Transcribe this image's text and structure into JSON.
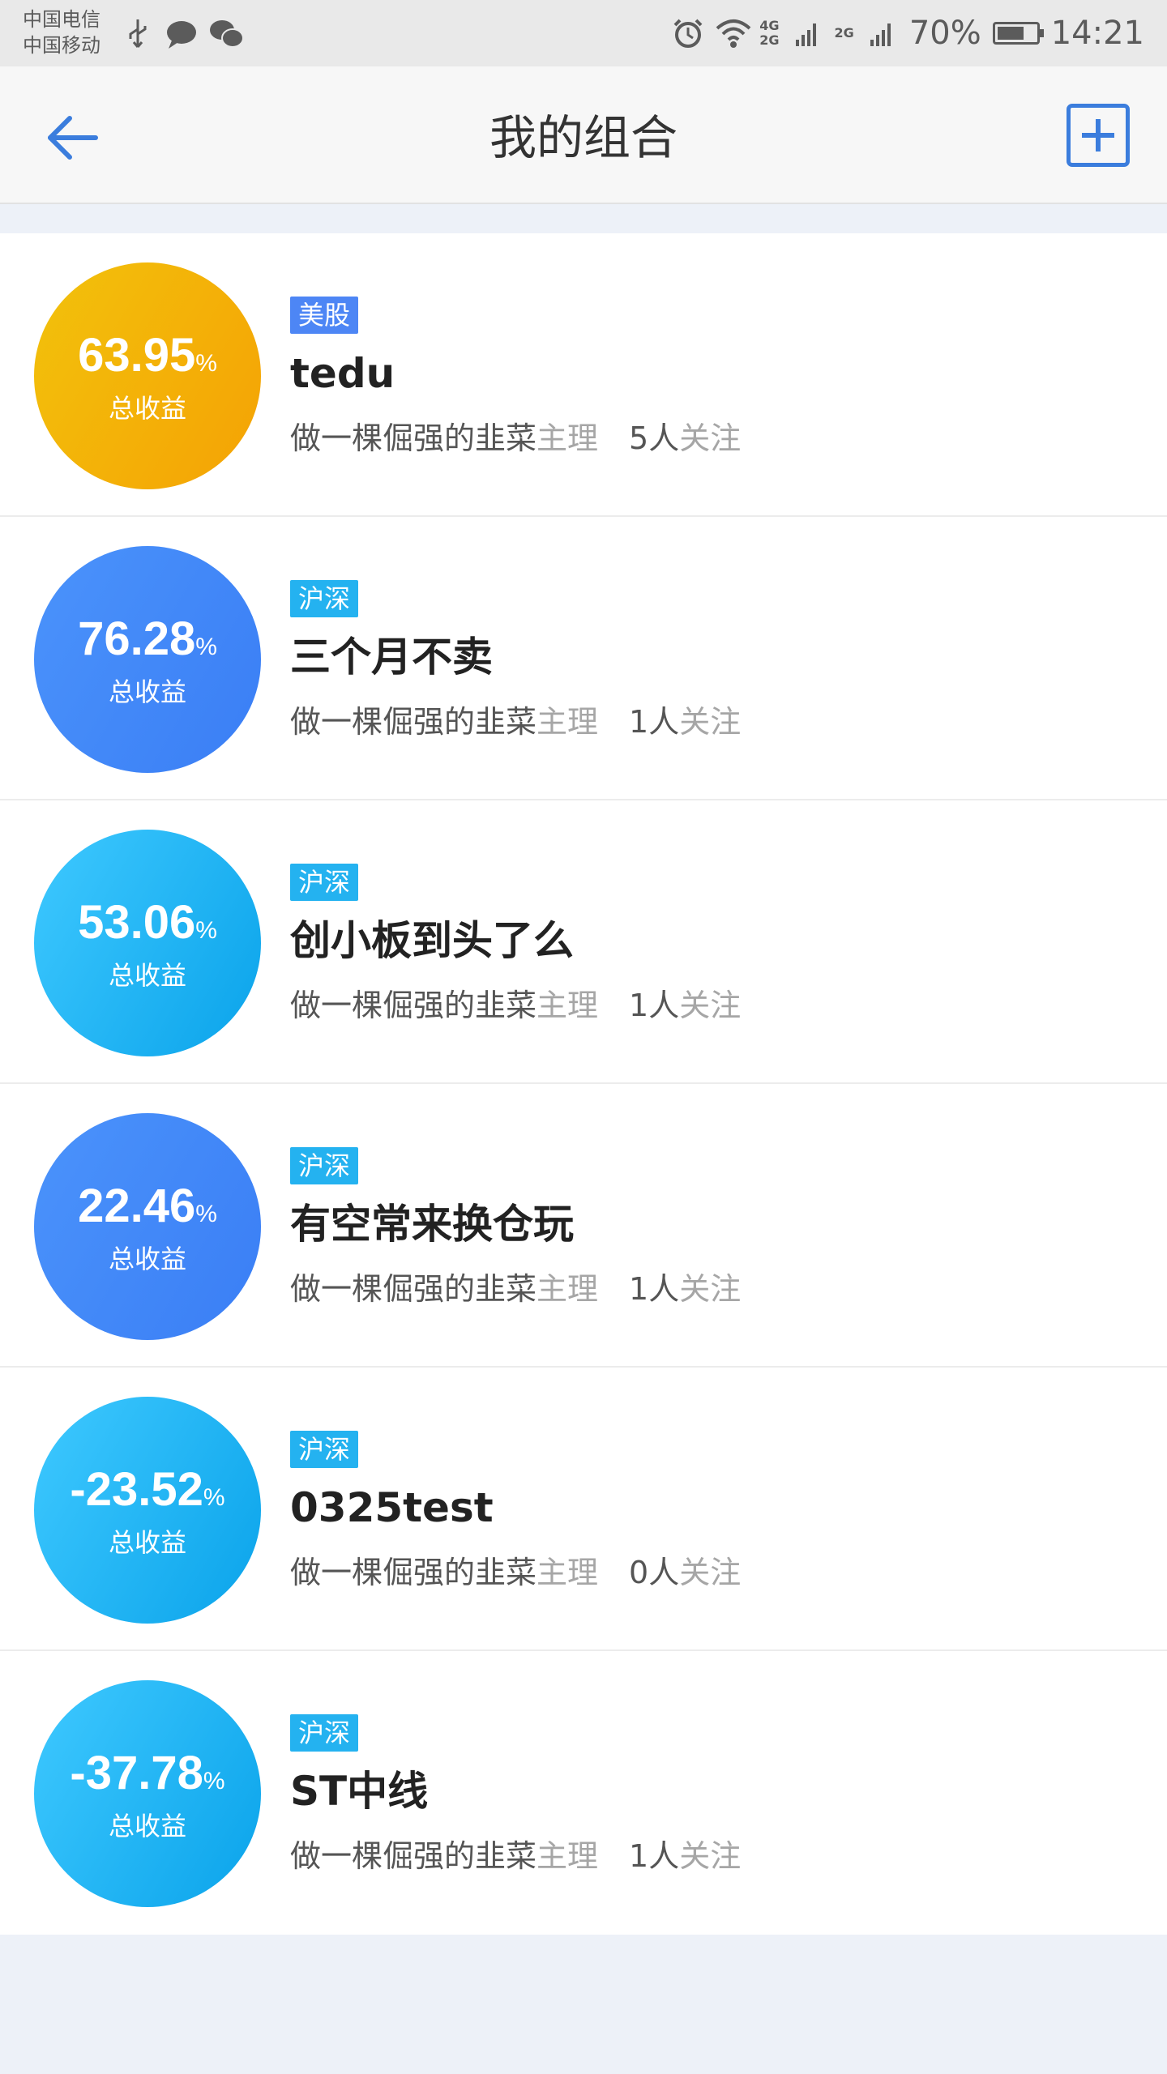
{
  "status_bar": {
    "carrier_1": "中国电信",
    "carrier_2": "中国移动",
    "net_a_top": "4G",
    "net_a_bottom": "2G",
    "net_b": "2G",
    "battery_percent": "70%",
    "battery_level": 0.7,
    "time": "14:21"
  },
  "header": {
    "title": "我的组合"
  },
  "colors": {
    "accent": "#3b7ddd",
    "gold": "#f2c20c",
    "blue": "#4b93fb",
    "cyan": "#3fc9ff"
  },
  "portfolios": [
    {
      "return_value": "63.95",
      "return_unit": "%",
      "return_label": "总收益",
      "market_tag": "美股",
      "name": "tedu",
      "owner": "做一棵倔强的韭菜",
      "owner_suffix": "主理",
      "followers": "5人",
      "followers_suffix": "关注"
    },
    {
      "return_value": "76.28",
      "return_unit": "%",
      "return_label": "总收益",
      "market_tag": "沪深",
      "name": "三个月不卖",
      "owner": "做一棵倔强的韭菜",
      "owner_suffix": "主理",
      "followers": "1人",
      "followers_suffix": "关注"
    },
    {
      "return_value": "53.06",
      "return_unit": "%",
      "return_label": "总收益",
      "market_tag": "沪深",
      "name": "创小板到头了么",
      "owner": "做一棵倔强的韭菜",
      "owner_suffix": "主理",
      "followers": "1人",
      "followers_suffix": "关注"
    },
    {
      "return_value": "22.46",
      "return_unit": "%",
      "return_label": "总收益",
      "market_tag": "沪深",
      "name": "有空常来换仓玩",
      "owner": "做一棵倔强的韭菜",
      "owner_suffix": "主理",
      "followers": "1人",
      "followers_suffix": "关注"
    },
    {
      "return_value": "-23.52",
      "return_unit": "%",
      "return_label": "总收益",
      "market_tag": "沪深",
      "name": "0325test",
      "owner": "做一棵倔强的韭菜",
      "owner_suffix": "主理",
      "followers": "0人",
      "followers_suffix": "关注"
    },
    {
      "return_value": "-37.78",
      "return_unit": "%",
      "return_label": "总收益",
      "market_tag": "沪深",
      "name": "ST中线",
      "owner": "做一棵倔强的韭菜",
      "owner_suffix": "主理",
      "followers": "1人",
      "followers_suffix": "关注"
    }
  ]
}
